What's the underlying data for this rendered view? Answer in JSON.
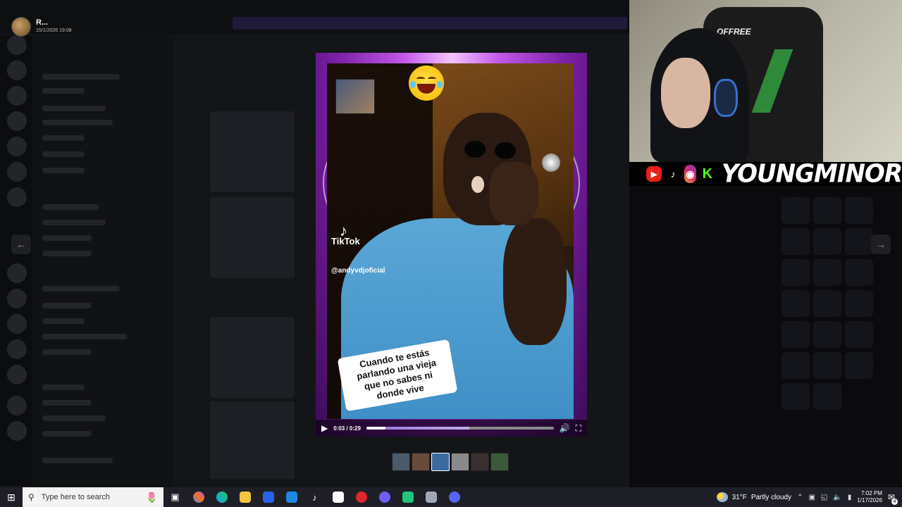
{
  "viewer": {
    "sender_name": "R...",
    "sender_date": "15/1/2026 19:08",
    "prev_icon": "arrow-left-icon",
    "next_icon": "arrow-right-icon"
  },
  "video": {
    "watermark_app": "TikTok",
    "watermark_handle": "@andyvdjoficial",
    "caption": "Cuando te estás\nparlando una vieja\nque no sabes ni\ndonde vive",
    "time": "0:03 / 0:29",
    "progress": 0.103,
    "play_icon": "play-icon",
    "volume_icon": "volume-icon",
    "fullscreen_icon": "fullscreen-icon"
  },
  "thumbnails": {
    "count": 6,
    "active_index": 2
  },
  "stream_overlay": {
    "brand": "YOUNGMINOR",
    "chair_brand": "OFFREE",
    "socials": [
      "youtube-icon",
      "tiktok-icon",
      "instagram-icon",
      "kick-icon"
    ],
    "kick_letter": "K"
  },
  "taskbar": {
    "search_placeholder": "Type here to search",
    "weather_temp": "31°F",
    "weather_desc": "Partly cloudy",
    "time": "7:02 PM",
    "date": "1/17/2026",
    "notification_count": "4",
    "apps": [
      "task-view-icon",
      "copilot-icon",
      "edge-icon",
      "file-explorer-icon",
      "store-icon",
      "mail-icon",
      "tiktok-icon",
      "capcut-icon",
      "opera-icon",
      "obs-icon",
      "app-icon",
      "app-icon",
      "discord-icon"
    ]
  },
  "colors": {
    "purple_frame": "#c257e8",
    "youtube_red": "#e62117",
    "kick_green": "#53fc18",
    "taskbar_bg": "#1e1f26",
    "shirt_blue": "#5aa7d6"
  }
}
